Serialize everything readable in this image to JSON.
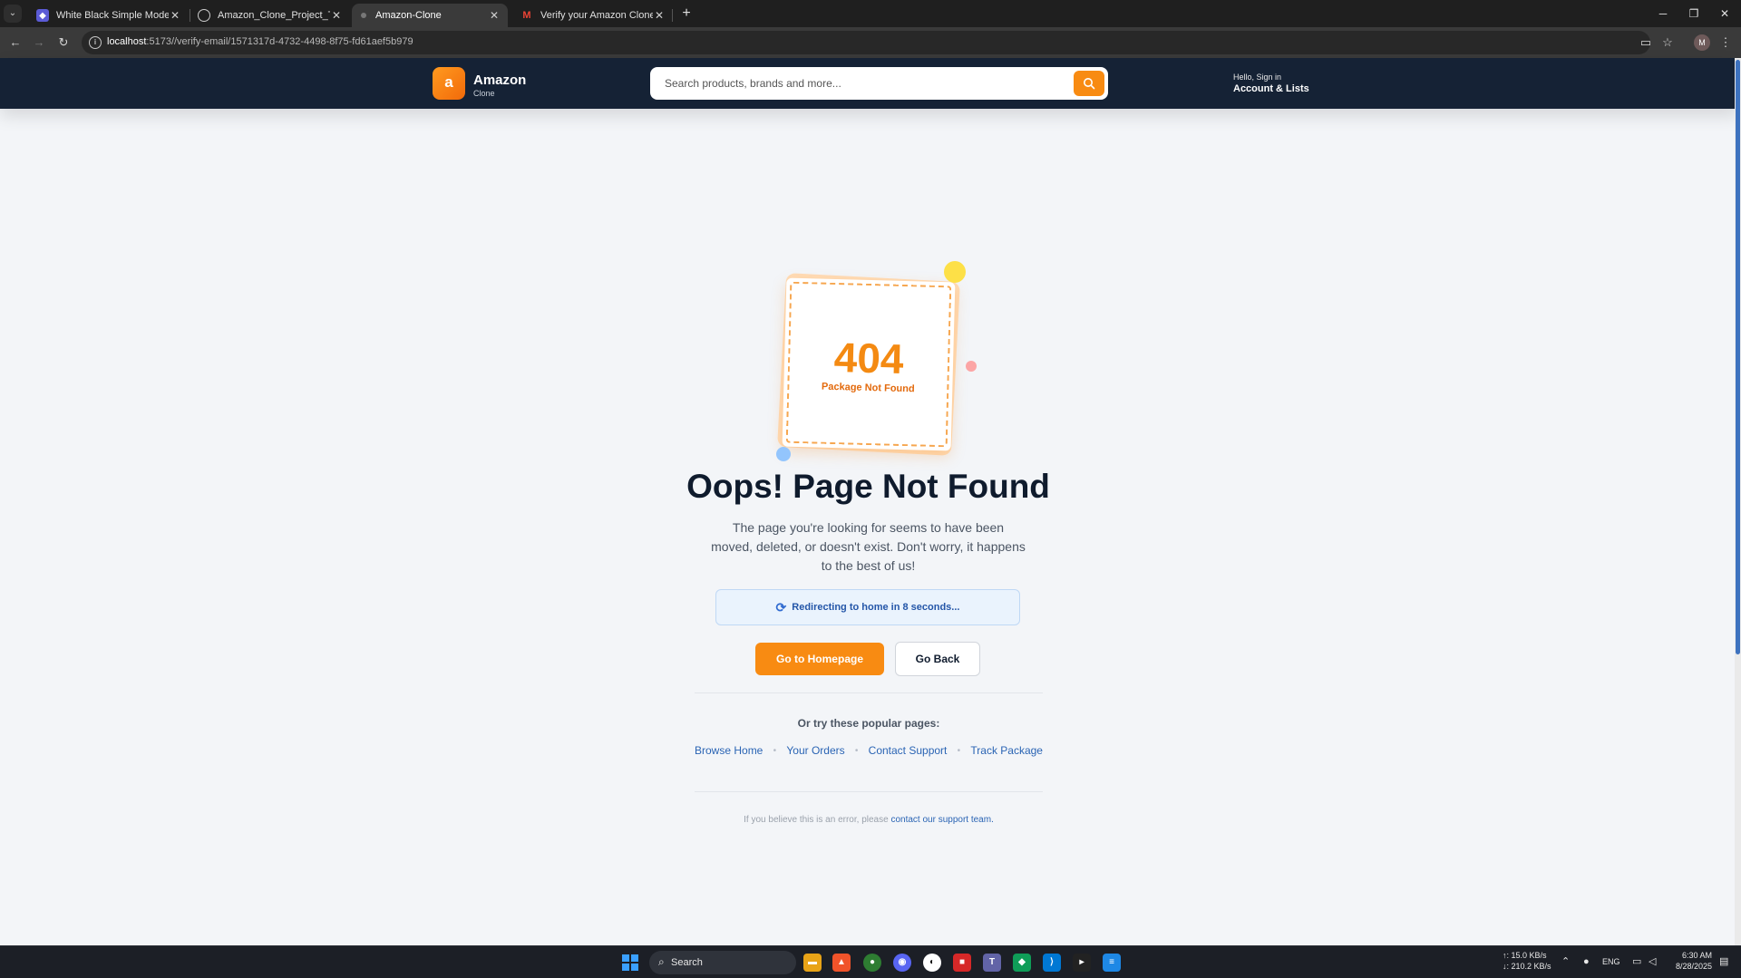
{
  "browser": {
    "tabs": [
      {
        "label": "White Black Simple Modern Te",
        "icon": "shield-app-icon",
        "active": false
      },
      {
        "label": "Amazon_Clone_Project_Tasks.p",
        "icon": "globe-icon",
        "active": false
      },
      {
        "label": "Amazon-Clone",
        "icon": "site-favicon",
        "active": true
      },
      {
        "label": "Verify your Amazon Clone acco",
        "icon": "gmail-icon",
        "active": false
      }
    ],
    "url_host": "localhost",
    "url_path": ":5173//verify-email/1571317d-4732-4498-8f75-fd61aef5b979",
    "profile_initial": "M"
  },
  "header": {
    "logo_letter": "a",
    "logo_title": "Amazon",
    "logo_subtitle": "Clone",
    "search_placeholder": "Search products, brands and more...",
    "account_greeting": "Hello, Sign in",
    "account_label": "Account & Lists"
  },
  "illustration": {
    "code": "404",
    "caption": "Package Not Found"
  },
  "main": {
    "headline": "Oops! Page Not Found",
    "description": "The page you're looking for seems to have been moved, deleted, or doesn't exist. Don't worry, it happens to the best of us!",
    "redirect_text": "Redirecting to home in 8 seconds...",
    "primary_button": "Go to Homepage",
    "secondary_button": "Go Back",
    "popular_heading": "Or try these popular pages:",
    "popular_links": [
      "Browse Home",
      "Your Orders",
      "Contact Support",
      "Track Package"
    ],
    "link_separator": "•",
    "footnote_text": "If you believe this is an error, please",
    "footnote_link": "contact our support team."
  },
  "taskbar": {
    "search_label": "Search",
    "net_up": "↑: 15.0 KB/s",
    "net_down": "↓: 210.2 KB/s",
    "language": "ENG",
    "time": "6:30 AM",
    "date": "8/28/2025"
  },
  "colors": {
    "accent": "#f88b12",
    "header_bg": "#152235",
    "link": "#2a64b4"
  }
}
